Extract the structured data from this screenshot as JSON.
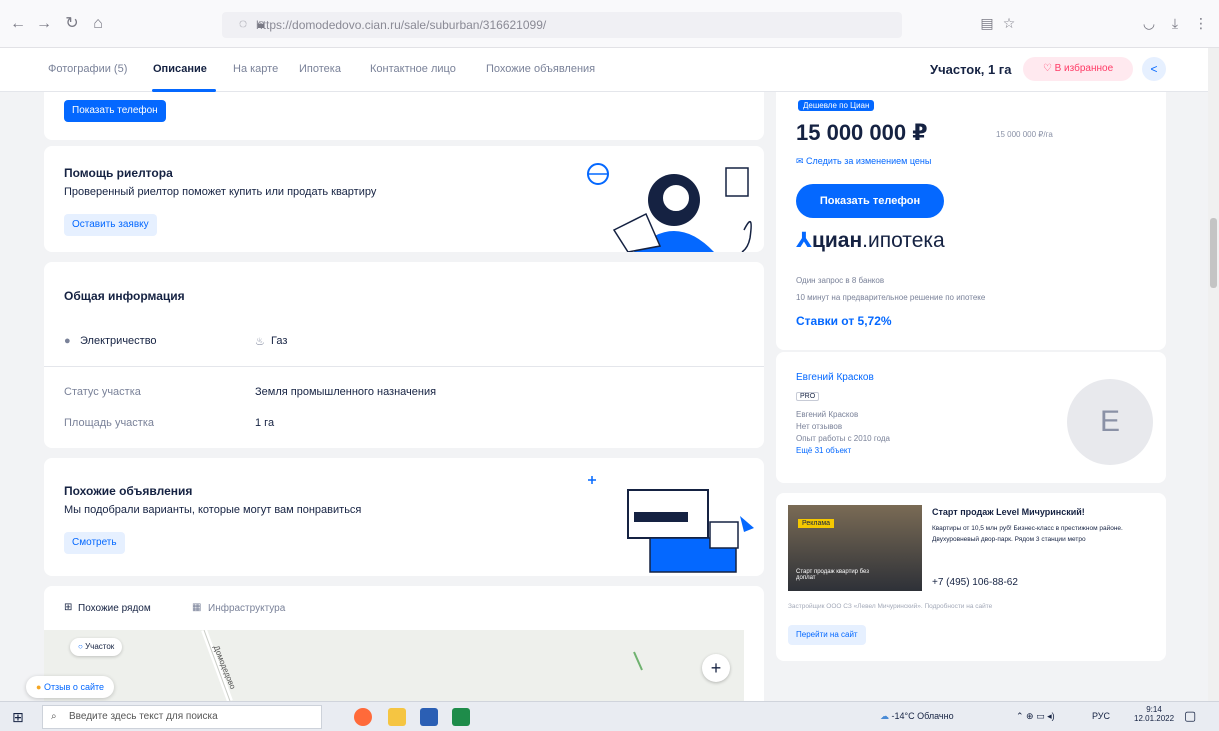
{
  "browser": {
    "url": "https://domodedovo.cian.ru/sale/suburban/316621099/",
    "url_domain": "cian.ru"
  },
  "tabs": {
    "items": [
      "Фотографии (5)",
      "Описание",
      "На карте",
      "Ипотека",
      "Контактное лицо",
      "Похожие объявления"
    ],
    "lot_title": "Участок, 1 га",
    "favorite_label": "В избранное"
  },
  "top_card": {
    "show_phone": "Показать телефон"
  },
  "realtor": {
    "title": "Помощь риелтора",
    "text": "Проверенный риелтор поможет купить или продать квартиру",
    "button": "Оставить заявку"
  },
  "general": {
    "title": "Общая информация",
    "amenity_1": "Электричество",
    "amenity_2": "Газ",
    "status_label": "Статус участка",
    "status_value": "Земля промышленного назначения",
    "area_label": "Площадь участка",
    "area_value": "1 га"
  },
  "similar": {
    "title": "Похожие объявления",
    "text": "Мы подобрали варианты, которые могут вам понравиться",
    "button": "Смотреть"
  },
  "map_section": {
    "tab_1": "Похожие рядом",
    "tab_2": "Инфраструктура",
    "pin_label": "Участок",
    "road_label": "Домодедово",
    "zoom_plus": "+"
  },
  "feedback": "Отзыв о сайте",
  "price_card": {
    "badge": "Дешевле по Циан",
    "price": "15 000 000 ₽",
    "price_per": "15 000 000 ₽/га",
    "track": "Следить за изменением цены",
    "phone_btn": "Показать телефон",
    "logo_main": "циан",
    "logo_sub": ".ипотека",
    "line_1": "Один запрос в 8 банков",
    "line_2": "10 минут на предварительное решение по ипотеке",
    "rate": "Ставки от 5,72%"
  },
  "agent": {
    "name": "Евгений Красков",
    "badge": "PRO",
    "line_1": "Евгений Красков",
    "line_2": "Нет отзывов",
    "line_3": "Опыт работы с 2010 года",
    "more": "Ещё 31 объект",
    "initial": "E"
  },
  "ad": {
    "sticker": "Реклама",
    "img_caption": "Старт продаж квартир без доплат",
    "title": "Старт продаж Level Мичуринский!",
    "text": "Квартиры от 10,5 млн руб! Бизнес-класс в престижном районе. Двухуровневый двор-парк. Рядом 3 станции метро",
    "phone": "+7 (495) 106-88-62",
    "legal": "Застройщик ООО СЗ «Левел Мичуринский». Подробности на сайте",
    "button": "Перейти на сайт"
  },
  "taskbar": {
    "search_placeholder": "Введите здесь текст для поиска",
    "weather": "-14°C Облачно",
    "lang": "РУС",
    "time": "9:14",
    "date": "12.01.2022"
  },
  "colors": {
    "accent": "#0468ff",
    "text": "#152242",
    "muted": "#7a8299",
    "bg": "#f2f3f5"
  }
}
